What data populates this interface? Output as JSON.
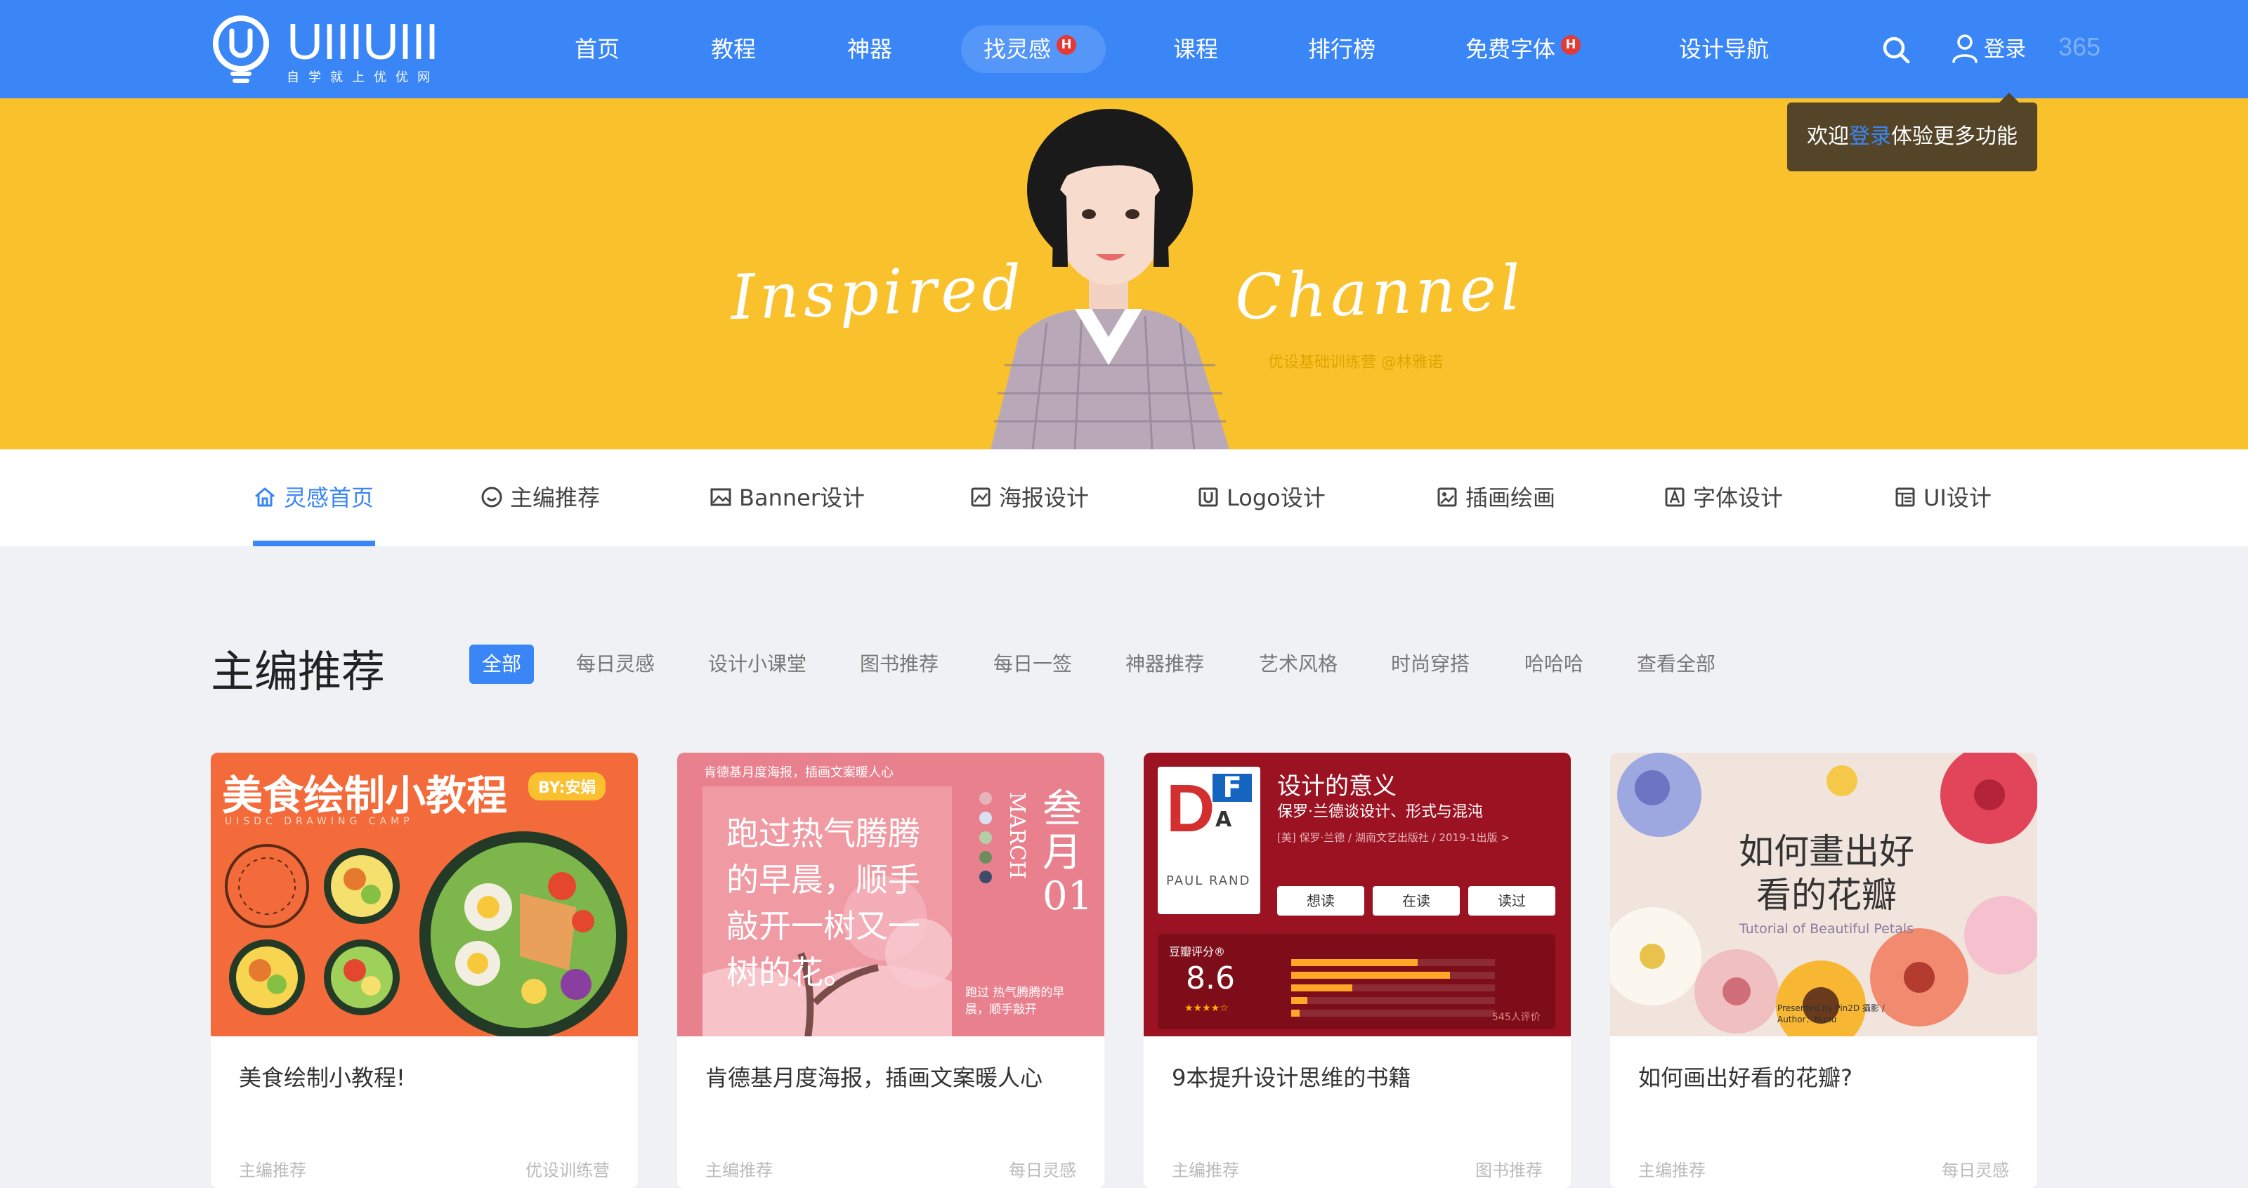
{
  "brand": {
    "logo_text": "UIIIUIII",
    "tagline": "自学就上优优网"
  },
  "nav": {
    "items": [
      {
        "label": "首页"
      },
      {
        "label": "教程"
      },
      {
        "label": "神器"
      },
      {
        "label": "找灵感",
        "badge": "H"
      },
      {
        "label": "课程"
      },
      {
        "label": "排行榜"
      },
      {
        "label": "免费字体",
        "badge": "H"
      },
      {
        "label": "设计导航"
      }
    ],
    "login": "登录",
    "badge365": "365"
  },
  "tooltip": {
    "prefix": "欢迎",
    "link": "登录",
    "suffix": "体验更多功能"
  },
  "banner": {
    "left_text": "Inspired",
    "right_text": "Channel",
    "credit": "优设基础训练营 @林雅诺"
  },
  "tabs": [
    {
      "label": "灵感首页",
      "icon": "home-icon"
    },
    {
      "label": "主编推荐",
      "icon": "smile-icon"
    },
    {
      "label": "Banner设计",
      "icon": "image-icon"
    },
    {
      "label": "海报设计",
      "icon": "poster-icon"
    },
    {
      "label": "Logo设计",
      "icon": "logo-u-icon"
    },
    {
      "label": "插画绘画",
      "icon": "illustration-icon"
    },
    {
      "label": "字体设计",
      "icon": "font-a-icon"
    },
    {
      "label": "UI设计",
      "icon": "ui-layout-icon"
    }
  ],
  "section": {
    "title": "主编推荐",
    "filters": [
      "全部",
      "每日灵感",
      "设计小课堂",
      "图书推荐",
      "每日一签",
      "神器推荐",
      "艺术风格",
      "时尚穿搭",
      "哈哈哈",
      "查看全部"
    ]
  },
  "cards": [
    {
      "title": "美食绘制小教程!",
      "foot_left": "主编推荐",
      "foot_right": "优设训练营",
      "img_heading": "美食绘制小教程",
      "img_tag": "BY:安娟",
      "img_sub": "UISDC DRAWING CAMP"
    },
    {
      "title": "肯德基月度海报，插画文案暖人心",
      "foot_left": "主编推荐",
      "foot_right": "每日灵感",
      "img_top": "肯德基月度海报，插画文案暖人心",
      "img_month": "叁月01",
      "img_march": "MARCH",
      "img_hand": "跑过热气腾腾的早晨，顺手敲开一树又一树的花。",
      "img_small": "跑过 热气腾腾的早晨，顺手敲开"
    },
    {
      "title": "9本提升设计思维的书籍",
      "foot_left": "主编推荐",
      "foot_right": "图书推荐",
      "img_book_title": "设计的意义",
      "img_book_sub": "保罗·兰德谈设计、形式与混沌",
      "img_book_meta": "[美] 保罗·兰德 / 湖南文艺出版社 / 2019-1出版 >",
      "img_author": "PAUL RAND",
      "img_btns": [
        "想读",
        "在读",
        "读过"
      ],
      "img_rating_label": "豆瓣评分®",
      "img_rating": "8.6",
      "img_count": "545人评价",
      "rating_bars": [
        0.62,
        0.78,
        0.3,
        0.08,
        0.04
      ]
    },
    {
      "title": "如何画出好看的花瓣?",
      "foot_left": "主编推荐",
      "foot_right": "每日灵感",
      "img_heading": "如何畫出好看的花瓣",
      "img_en": "Tutorial of Beautiful Petals",
      "img_credit": "Presented by Pin2D 攝影 / Author：Nunu"
    }
  ],
  "colors": {
    "primary": "#3a86f7",
    "banner": "#f9c22c",
    "badge": "#e53935",
    "tooltip": "#544528"
  }
}
